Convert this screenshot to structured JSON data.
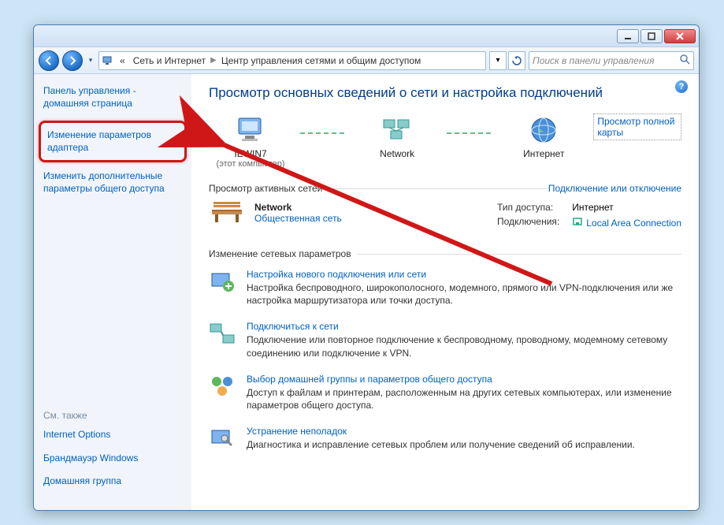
{
  "breadcrumbs": {
    "prefix": "«",
    "part1": "Сеть и Интернет",
    "part2": "Центр управления сетями и общим доступом"
  },
  "search": {
    "placeholder": "Поиск в панели управления"
  },
  "sidebar": {
    "home": "Панель управления - домашняя страница",
    "adapter_settings": "Изменение параметров адаптера",
    "advanced_sharing": "Изменить дополнительные параметры общего доступа",
    "see_also_h": "См. также",
    "see_also": {
      "internet_options": "Internet Options",
      "firewall": "Брандмауэр Windows",
      "homegroup": "Домашняя группа"
    }
  },
  "main": {
    "title": "Просмотр основных сведений о сети и настройка подключений",
    "view_full_map": "Просмотр полной карты",
    "nodes": {
      "computer": {
        "label": "IEWIN7",
        "sub": "(этот компьютер)"
      },
      "network": {
        "label": "Network"
      },
      "internet": {
        "label": "Интернет"
      }
    },
    "active_networks_h": "Просмотр активных сетей",
    "connect_toggle": "Подключение или отключение",
    "network": {
      "name": "Network",
      "type": "Общественная сеть",
      "access_label": "Тип доступа:",
      "access_value": "Интернет",
      "connections_label": "Подключения:",
      "connections_value": "Local Area Connection"
    },
    "change_settings_h": "Изменение сетевых параметров",
    "tasks": [
      {
        "title": "Настройка нового подключения или сети",
        "desc": "Настройка беспроводного, широкополосного, модемного, прямого или VPN-подключения или же настройка маршрутизатора или точки доступа."
      },
      {
        "title": "Подключиться к сети",
        "desc": "Подключение или повторное подключение к беспроводному, проводному, модемному сетевому соединению или подключение к VPN."
      },
      {
        "title": "Выбор домашней группы и параметров общего доступа",
        "desc": "Доступ к файлам и принтерам, расположенным на других сетевых компьютерах, или изменение параметров общего доступа."
      },
      {
        "title": "Устранение неполадок",
        "desc": "Диагностика и исправление сетевых проблем или получение сведений об исправлении."
      }
    ]
  }
}
